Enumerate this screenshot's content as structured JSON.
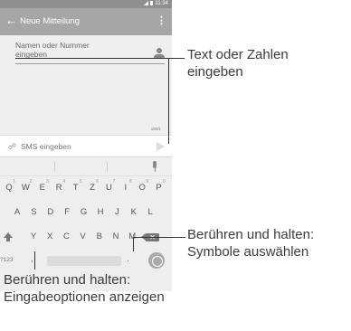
{
  "status_bar": {
    "time": "11:34"
  },
  "app_bar": {
    "back_icon": "←",
    "title": "Neue Mitteilung",
    "more_icon": "⋮"
  },
  "recipient": {
    "placeholder_line1": "Namen oder Nummer",
    "placeholder_line2": "eingeben",
    "icon": "person-icon"
  },
  "compose": {
    "counter": "160/1",
    "placeholder": "SMS eingeben",
    "attach_icon": "paperclip-icon",
    "send_icon": "send-icon"
  },
  "keyboard": {
    "row1": [
      {
        "key": "Q",
        "sup": "1"
      },
      {
        "key": "W",
        "sup": "2"
      },
      {
        "key": "E",
        "sup": "3"
      },
      {
        "key": "R",
        "sup": "4"
      },
      {
        "key": "T",
        "sup": "5"
      },
      {
        "key": "Z",
        "sup": "6"
      },
      {
        "key": "U",
        "sup": "7"
      },
      {
        "key": "I",
        "sup": "8"
      },
      {
        "key": "O",
        "sup": "9"
      },
      {
        "key": "P",
        "sup": "0"
      }
    ],
    "row2": [
      "A",
      "S",
      "D",
      "F",
      "G",
      "H",
      "J",
      "K",
      "L"
    ],
    "row3": [
      "Y",
      "X",
      "C",
      "V",
      "B",
      "N",
      "M"
    ],
    "symbols_key": "?123",
    "comma_key": ",",
    "period_key": ".",
    "backspace_glyph": "✕"
  },
  "callouts": {
    "text_input": {
      "line1": "Text oder Zahlen",
      "line2": "eingeben"
    },
    "symbols": {
      "line1": "Berühren und halten:",
      "line2": "Symbole auswählen"
    },
    "input_options": {
      "line1": "Berühren und halten:",
      "line2": "Eingabeoptionen anzeigen"
    }
  }
}
